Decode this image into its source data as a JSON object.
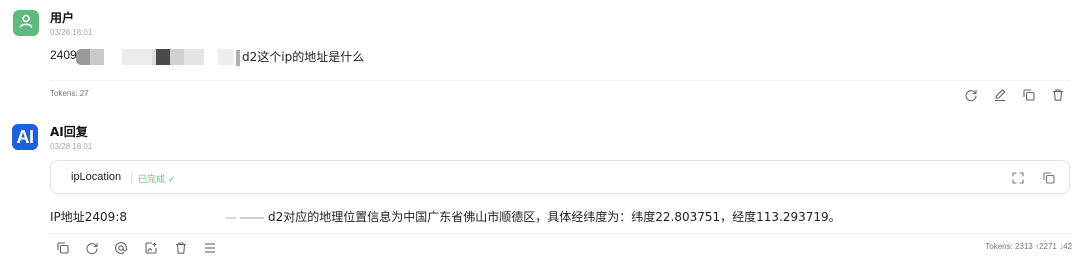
{
  "user_message": {
    "sender": "用户",
    "time": "03/28 18:01",
    "text_prefix": "2409",
    "text_suffix": "d2这个ip的地址是什么",
    "tokens": "Tokens: 27"
  },
  "ai_message": {
    "sender": "AI回复",
    "avatar_label": "AI",
    "time": "03/28 18:01",
    "tool": {
      "name": "ipLocation",
      "status": "已完成 ✓"
    },
    "text_prefix": "IP地址2409:8",
    "text_suffix": "d2对应的地理位置信息为中国广东省佛山市顺德区，具体经纬度为：纬度22.803751，经度113.293719。",
    "tokens": "Tokens: 2313 ↑2271 ↓42"
  },
  "colors": {
    "user_avatar": "#5cba7d",
    "ai_avatar": "#1f5fe0",
    "status_done": "#6cc07d"
  },
  "icons": {
    "user_actions": [
      "refresh-icon",
      "edit-icon",
      "copy-icon",
      "delete-icon"
    ],
    "tool_actions": [
      "expand-icon",
      "copy-icon"
    ],
    "ai_actions": [
      "copy-icon",
      "refresh-icon",
      "mention-icon",
      "add-image-icon",
      "delete-icon",
      "menu-icon"
    ]
  }
}
